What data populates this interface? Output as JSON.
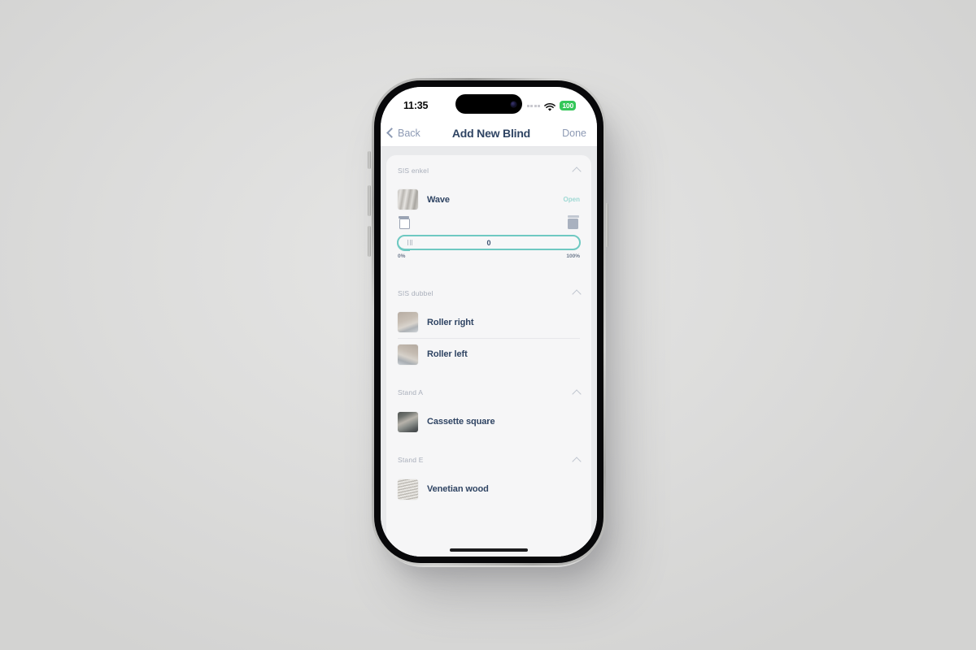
{
  "statusbar": {
    "time": "11:35",
    "signal_icon": "cellular-dots-icon",
    "wifi_icon": "wifi-icon",
    "battery_level": "100"
  },
  "navbar": {
    "back_label": "Back",
    "back_icon": "chevron-left-icon",
    "title": "Add New Blind",
    "done_label": "Done"
  },
  "colors": {
    "accent_teal": "#6fc9c2",
    "status_open": "#9fd9d4",
    "title_navy": "#2f4463",
    "nav_muted": "#8d9ab4",
    "battery_green": "#34c759"
  },
  "sections": [
    {
      "title": "SIS enkel",
      "collapse_icon": "chevron-up-icon",
      "items": [
        {
          "name": "Wave",
          "status": "Open",
          "thumb": "wave-thumbnail"
        }
      ],
      "slider": {
        "open_icon": "blind-open-icon",
        "closed_icon": "blind-closed-icon",
        "value": "0",
        "min_label": "0%",
        "max_label": "100%"
      }
    },
    {
      "title": "SIS dubbel",
      "collapse_icon": "chevron-up-icon",
      "items": [
        {
          "name": "Roller right",
          "status": "",
          "thumb": "roller-right-thumbnail"
        },
        {
          "name": "Roller left",
          "status": "",
          "thumb": "roller-left-thumbnail"
        }
      ]
    },
    {
      "title": "Stand A",
      "collapse_icon": "chevron-up-icon",
      "items": [
        {
          "name": "Cassette square",
          "status": "",
          "thumb": "cassette-square-thumbnail"
        }
      ]
    },
    {
      "title": "Stand E",
      "collapse_icon": "chevron-up-icon",
      "items": [
        {
          "name": "Venetian wood",
          "status": "",
          "thumb": "venetian-wood-thumbnail"
        }
      ]
    }
  ]
}
